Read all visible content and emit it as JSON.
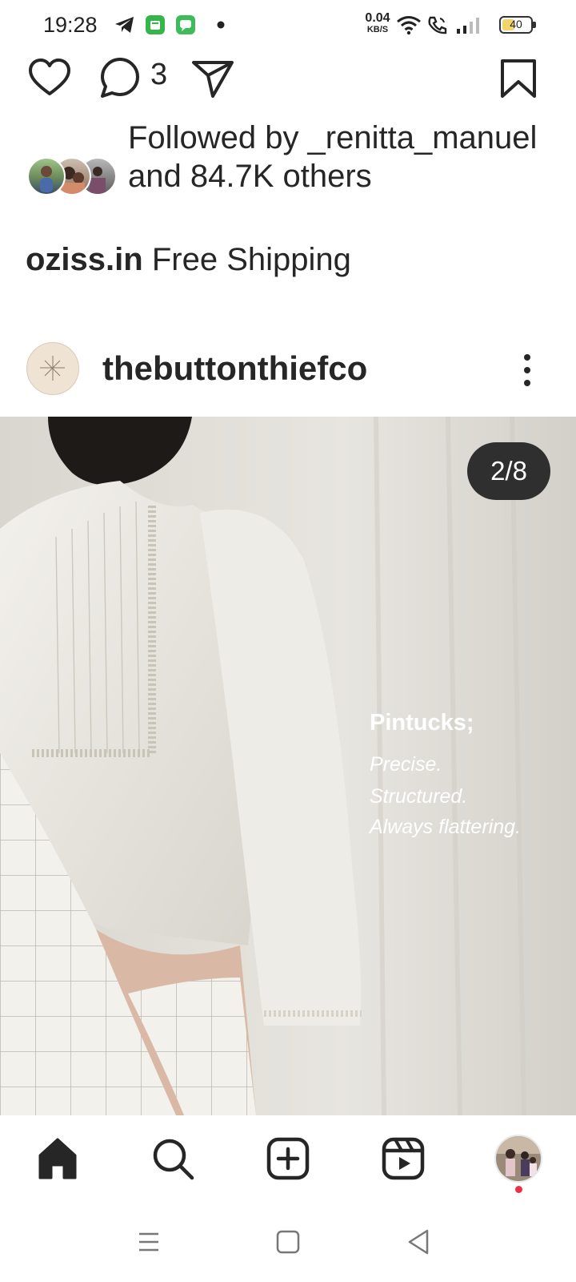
{
  "status_bar": {
    "time": "19:28",
    "net_speed_value": "0.04",
    "net_speed_unit": "KB/S",
    "battery_level": "40",
    "icons": [
      "telegram-icon",
      "app-notification-icon",
      "message-icon",
      "dot-icon",
      "wifi-icon",
      "call-icon",
      "signal-icon"
    ]
  },
  "post_actions": {
    "comment_count": "3",
    "icons": [
      "heart-icon",
      "comment-icon",
      "share-icon",
      "bookmark-icon"
    ]
  },
  "followed_by": {
    "text": "Followed by _renitta_manuel and 84.7K others"
  },
  "caption": {
    "account": "oziss.in",
    "text": "Free Shipping"
  },
  "post": {
    "username": "thebuttonthiefco",
    "counter": "2/8",
    "overlay": {
      "title": "Pintucks;",
      "lines": [
        "Precise.",
        "Structured.",
        "Always flattering."
      ]
    }
  },
  "bottom_nav": {
    "items": [
      "home-icon",
      "search-icon",
      "create-icon",
      "reels-icon",
      "profile-avatar"
    ],
    "notification_dot_color": "#ed2f45"
  },
  "system_nav": {
    "items": [
      "menu-icon",
      "home-square-icon",
      "back-icon"
    ]
  }
}
